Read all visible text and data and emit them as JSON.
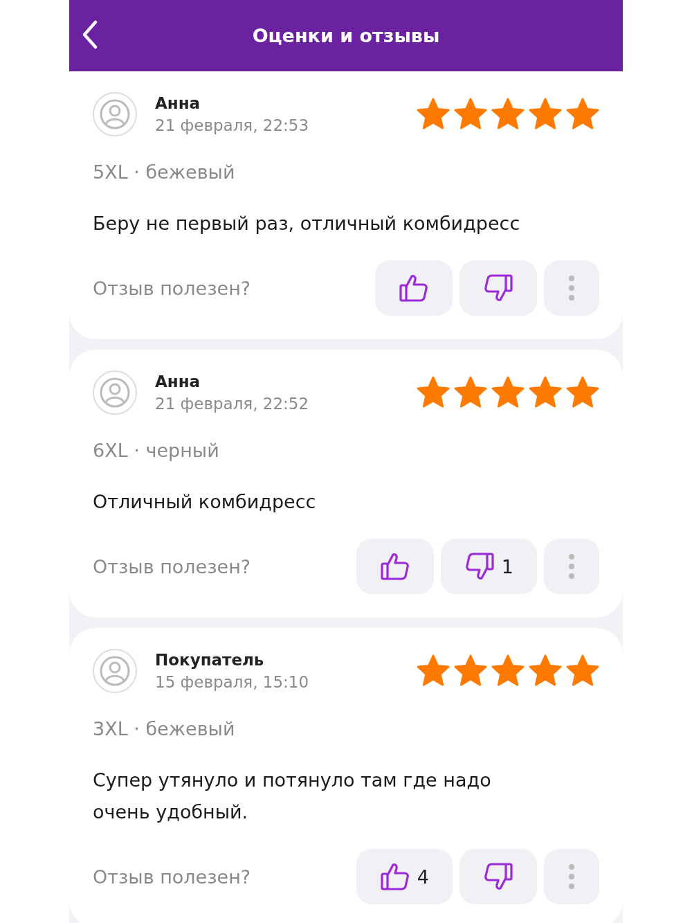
{
  "header": {
    "title": "Оценки и отзывы"
  },
  "reviews": [
    {
      "name": "Анна",
      "date": "21 февраля, 22:53",
      "stars": 5,
      "variant": "5XL · бежевый",
      "text": "Беру не первый раз, отличный комбидресс",
      "helpful_prompt": "Отзыв полезен?"
    },
    {
      "name": "Анна",
      "date": "21 февраля, 22:52",
      "stars": 5,
      "variant": "6XL · черный",
      "text": "Отличный комбидресс",
      "helpful_prompt": "Отзыв полезен?",
      "dislikes": "1"
    },
    {
      "name": "Покупатель",
      "date": "15 февраля, 15:10",
      "stars": 5,
      "variant": "3XL · бежевый",
      "text": "Супер утянуло и потянуло там где надо\nочень удобный.",
      "helpful_prompt": "Отзыв полезен?",
      "likes": "4"
    }
  ]
}
